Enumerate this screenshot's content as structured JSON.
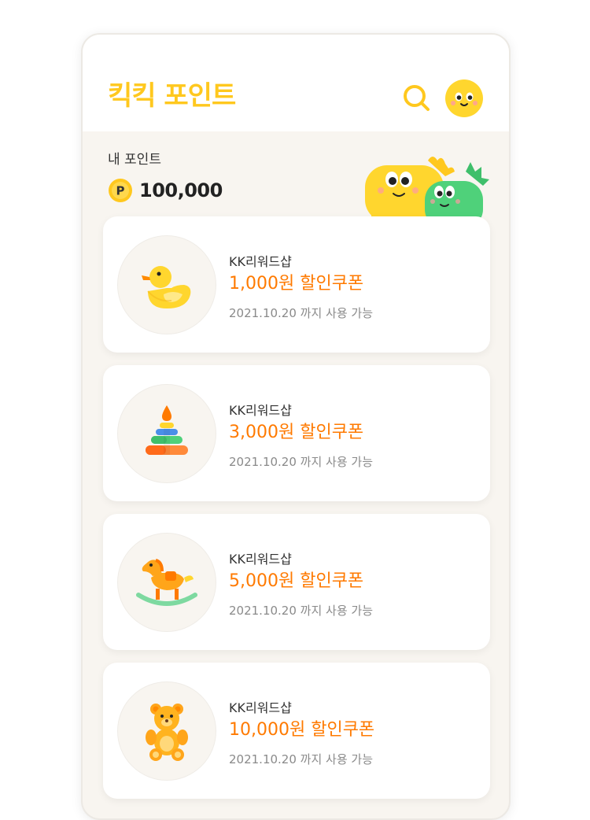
{
  "header": {
    "title": "킥킥 포인트"
  },
  "points": {
    "label": "내 포인트",
    "coin_symbol": "P",
    "value": "100,000"
  },
  "colors": {
    "brand_yellow": "#ffc81e",
    "coupon_orange": "#ff7a00",
    "background": "#f8f5f0"
  },
  "coupons": [
    {
      "shop": "KK리워드샵",
      "title": "1,000원 할인쿠폰",
      "expiry": "2021.10.20 까지 사용 가능",
      "icon": "duck-icon"
    },
    {
      "shop": "KK리워드샵",
      "title": "3,000원 할인쿠폰",
      "expiry": "2021.10.20 까지 사용 가능",
      "icon": "stacking-rings-icon"
    },
    {
      "shop": "KK리워드샵",
      "title": "5,000원 할인쿠폰",
      "expiry": "2021.10.20 까지 사용 가능",
      "icon": "rocking-horse-icon"
    },
    {
      "shop": "KK리워드샵",
      "title": "10,000원 할인쿠폰",
      "expiry": "2021.10.20 까지 사용 가능",
      "icon": "teddy-bear-icon"
    }
  ]
}
